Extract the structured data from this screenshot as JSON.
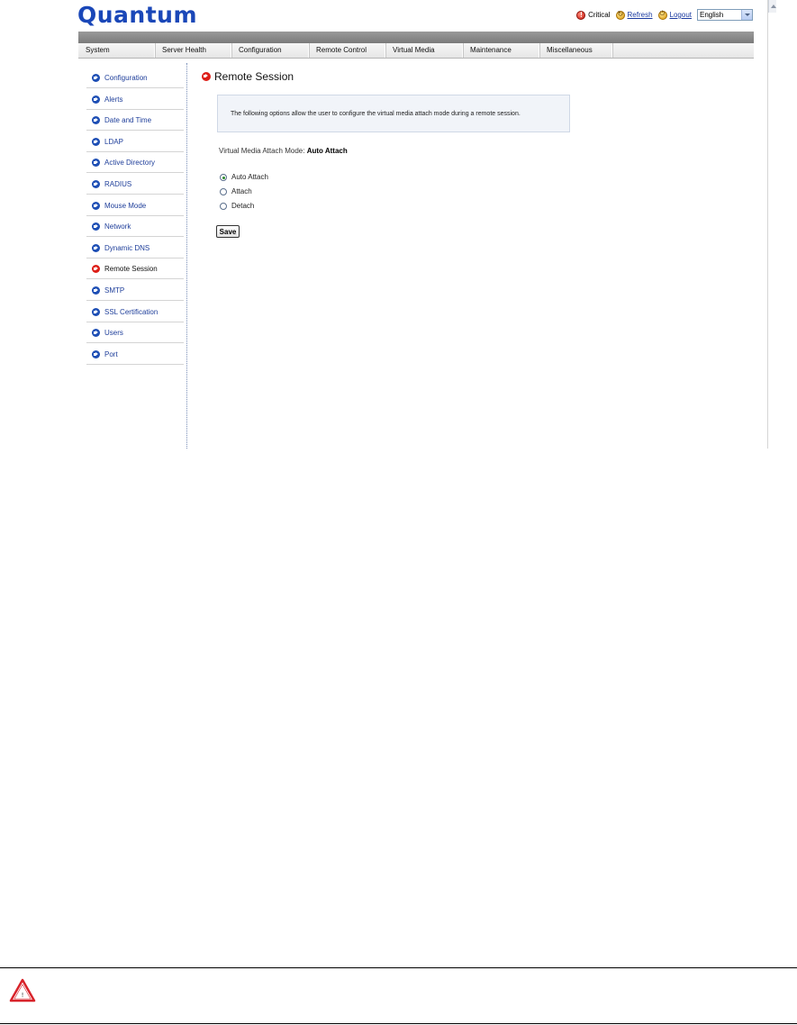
{
  "header": {
    "logo_text": "Quantum",
    "critical_label": "Critical",
    "refresh_label": "Refresh",
    "logout_label": "Logout",
    "language_selected": "English"
  },
  "nav": {
    "items": [
      "System",
      "Server Health",
      "Configuration",
      "Remote Control",
      "Virtual Media",
      "Maintenance",
      "Miscellaneous"
    ]
  },
  "sidebar": {
    "items": [
      {
        "label": "Configuration"
      },
      {
        "label": "Alerts"
      },
      {
        "label": "Date and Time"
      },
      {
        "label": "LDAP"
      },
      {
        "label": "Active Directory"
      },
      {
        "label": "RADIUS"
      },
      {
        "label": "Mouse Mode"
      },
      {
        "label": "Network"
      },
      {
        "label": "Dynamic DNS"
      },
      {
        "label": "Remote Session",
        "active": true
      },
      {
        "label": "SMTP"
      },
      {
        "label": "SSL Certification"
      },
      {
        "label": "Users"
      },
      {
        "label": "Port"
      }
    ]
  },
  "main": {
    "title": "Remote Session",
    "info_text": "The following options allow the user to configure the virtual media attach mode during a remote session.",
    "mode_label": "Virtual Media Attach Mode:",
    "mode_value": "Auto Attach",
    "options": [
      {
        "label": "Auto Attach",
        "selected": true
      },
      {
        "label": "Attach",
        "selected": false
      },
      {
        "label": "Detach",
        "selected": false
      }
    ],
    "save_label": "Save"
  },
  "colors": {
    "brand": "#1a47b8",
    "active_icon": "#dd1e17",
    "nav_icon": "#1e4fb5"
  }
}
